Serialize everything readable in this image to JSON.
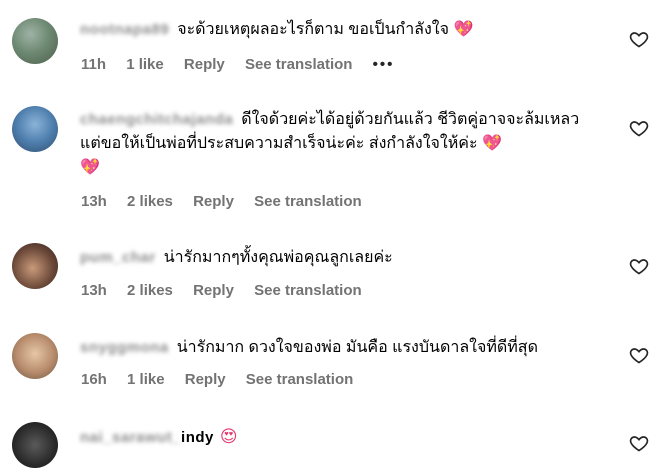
{
  "comments": [
    {
      "username": "nootnapa89",
      "text": "จะด้วยเหตุผลอะไรก็ตาม ขอเป็นกำลังใจ",
      "emoji": "💖",
      "time": "11h",
      "likes": "1 like",
      "reply": "Reply",
      "see_translation": "See translation",
      "more": "•••"
    },
    {
      "username": "chaengchitchajanda",
      "text": "ดีใจด้วยค่ะได้อยู่ด้วยกันแล้ว ชีวิตคู่อาจจะล้มเหลว แต่ขอให้เป็นพ่อที่ประสบความสำเร็จน่ะค่ะ ส่งกำลังใจให้ค่ะ",
      "emoji": "💖",
      "emoji2": "💖",
      "time": "13h",
      "likes": "2 likes",
      "reply": "Reply",
      "see_translation": "See translation"
    },
    {
      "username": "pum_char",
      "text": "น่ารักมากๆทั้งคุณพ่อคุณลูกเลยค่ะ",
      "time": "13h",
      "likes": "2 likes",
      "reply": "Reply",
      "see_translation": "See translation"
    },
    {
      "username": "snyggmona",
      "text": "น่ารักมาก ดวงใจของพ่อ มันคือ แรงบันดาลใจที่ดีที่สุด",
      "time": "16h",
      "likes": "1 like",
      "reply": "Reply",
      "see_translation": "See translation"
    },
    {
      "username_blurred": "nai_sarawut_",
      "username_visible": "indy",
      "emoji": "😍"
    }
  ],
  "icons": {
    "like": "heart-outline-icon",
    "more": "more-dots-icon"
  },
  "colors": {
    "meta": "#737373",
    "heart": "#e63b6f"
  }
}
